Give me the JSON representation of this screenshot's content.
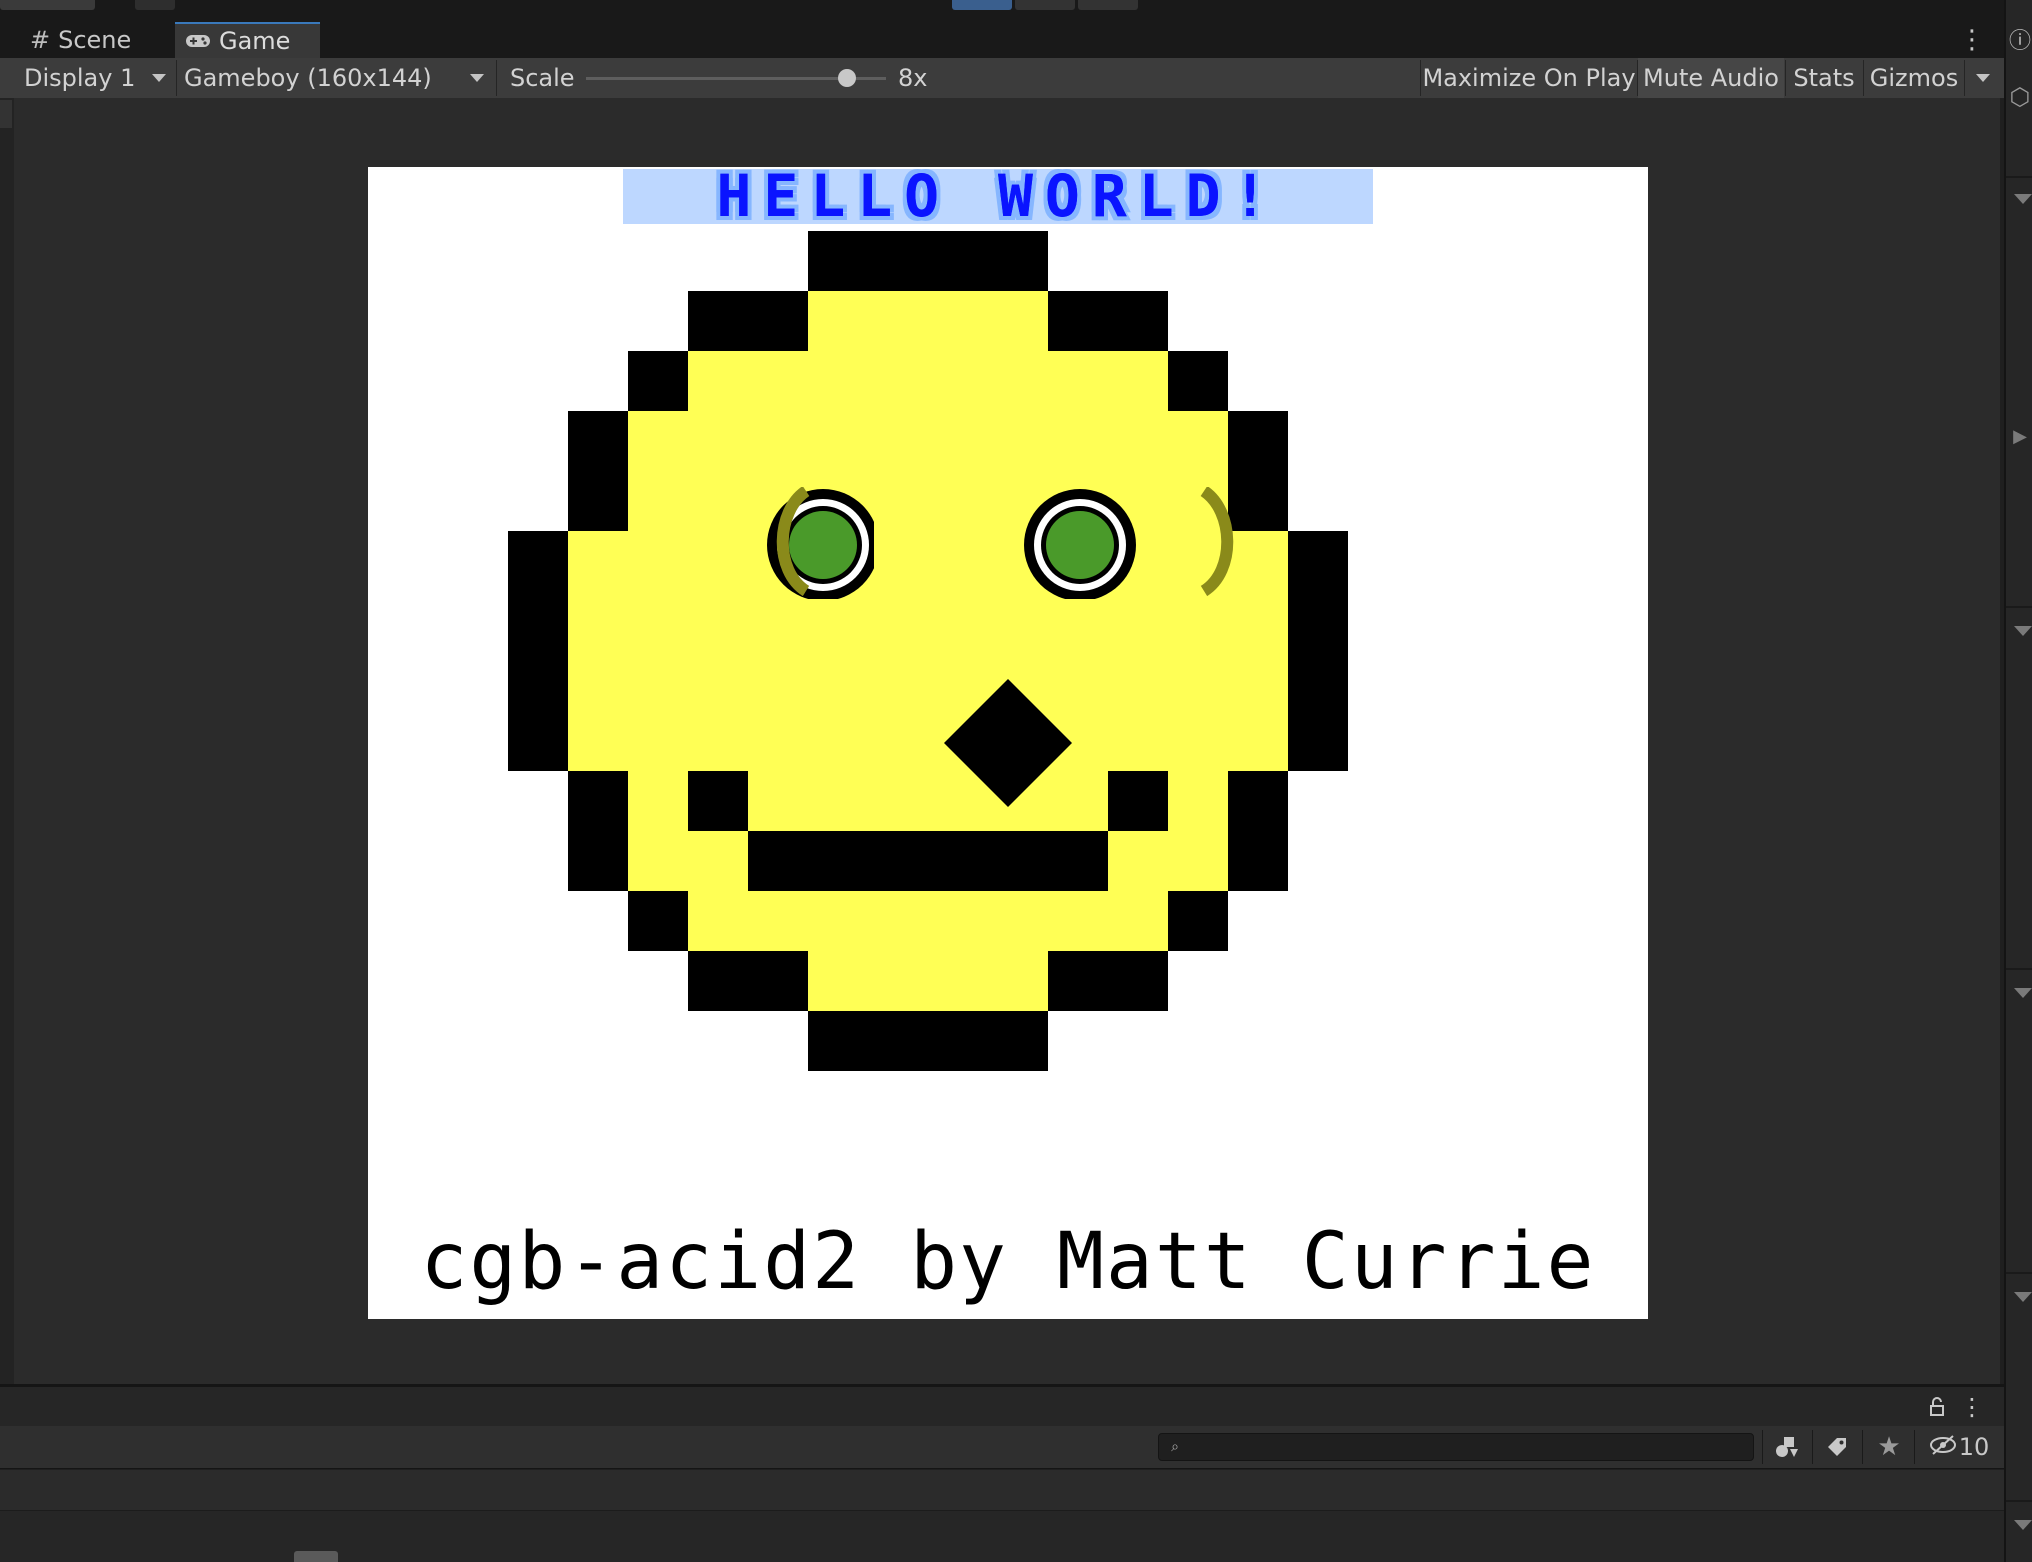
{
  "tabs": [
    {
      "label": "Scene",
      "icon": "hash-grid-icon"
    },
    {
      "label": "Game",
      "icon": "gamepad-icon"
    }
  ],
  "toolbar": {
    "display": "Display 1",
    "resolution": "Gameboy (160x144)",
    "scale_label": "Scale",
    "scale_value": "8x",
    "scale_slider_fraction": 0.87,
    "maximize_on_play": "Maximize On Play",
    "mute_audio": "Mute Audio",
    "stats": "Stats",
    "gizmos": "Gizmos"
  },
  "game": {
    "title": "HELLO WORLD!",
    "credit": "cgb-acid2 by Matt Currie"
  },
  "hierarchy": {
    "hidden_count": "10"
  },
  "colors": {
    "accent": "#3a79bb",
    "face_yellow": "#ffff55",
    "eye_green": "#4a9a2a",
    "title_blue": "#0a14ff"
  }
}
